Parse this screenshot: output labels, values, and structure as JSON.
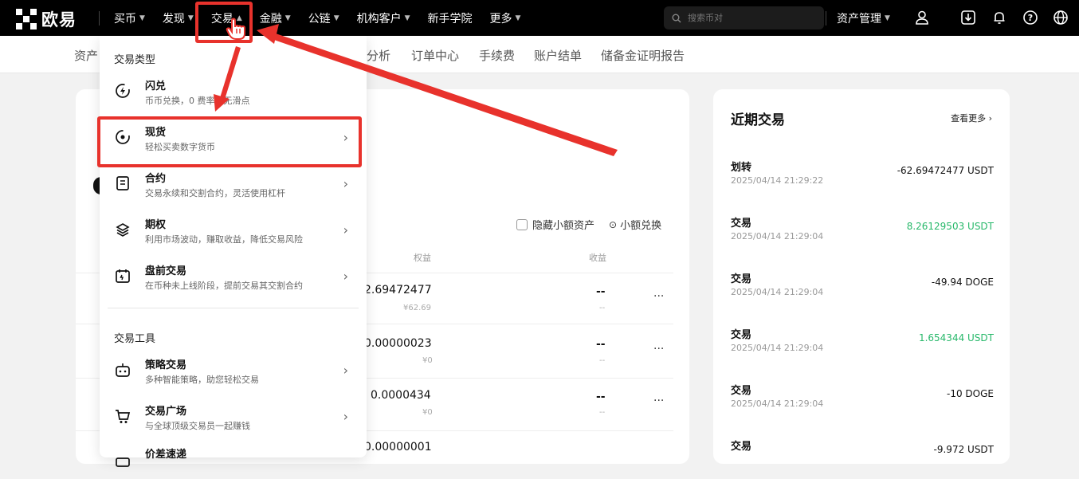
{
  "brand": {
    "name": "欧易"
  },
  "nav": {
    "items": [
      {
        "label": "买币",
        "chevron": true
      },
      {
        "label": "发现",
        "chevron": true
      },
      {
        "label": "交易",
        "chevron": true
      },
      {
        "label": "金融",
        "chevron": true
      },
      {
        "label": "公链",
        "chevron": true
      },
      {
        "label": "机构客户",
        "chevron": true
      },
      {
        "label": "新手学院",
        "chevron": false
      },
      {
        "label": "更多",
        "chevron": true
      }
    ],
    "search_placeholder": "搜索币对",
    "asset_management": "资产管理",
    "icons": [
      "user-icon",
      "download-icon",
      "bell-icon",
      "help-icon",
      "globe-icon"
    ]
  },
  "subnav": {
    "items": [
      "资产",
      "分析",
      "订单中心",
      "手续费",
      "账户结单",
      "储备金证明报告"
    ]
  },
  "dropdown": {
    "section1": "交易类型",
    "items1": [
      {
        "title": "闪兑",
        "desc": "币币兑换，0 费率，无滑点",
        "chevron": false,
        "icon": "flash-icon"
      },
      {
        "title": "现货",
        "desc": "轻松买卖数字货币",
        "chevron": true,
        "icon": "spot-icon"
      },
      {
        "title": "合约",
        "desc": "交易永续和交割合约，灵活使用杠杆",
        "chevron": true,
        "icon": "contract-icon"
      },
      {
        "title": "期权",
        "desc": "利用市场波动，赚取收益，降低交易风险",
        "chevron": true,
        "icon": "options-icon"
      },
      {
        "title": "盘前交易",
        "desc": "在币种未上线阶段，提前交易其交割合约",
        "chevron": true,
        "icon": "premarket-icon"
      }
    ],
    "section2": "交易工具",
    "items2": [
      {
        "title": "策略交易",
        "desc": "多种智能策略，助您轻松交易",
        "chevron": true,
        "icon": "bot-icon"
      },
      {
        "title": "交易广场",
        "desc": "与全球顶级交易员一起赚钱",
        "chevron": true,
        "icon": "cart-icon"
      },
      {
        "title": "价差速递",
        "desc": "",
        "chevron": false,
        "icon": "spread-icon"
      }
    ]
  },
  "assets": {
    "hide_small": "隐藏小额资产",
    "small_exchange": "小额兑换",
    "col_equity": "权益",
    "col_pnl": "收益",
    "rows": [
      {
        "amount": "2.69472477",
        "fiat": "¥62.69",
        "pnl": "--",
        "pnl_sub": "--"
      },
      {
        "amount": "0.00000023",
        "fiat": "¥0",
        "pnl": "--",
        "pnl_sub": "--"
      },
      {
        "amount": "0.0000434",
        "fiat": "¥0",
        "pnl": "--",
        "pnl_sub": "--"
      },
      {
        "amount": "0.00000001",
        "fiat": "",
        "pnl": "",
        "pnl_sub": ""
      }
    ],
    "more": "···"
  },
  "recent": {
    "title": "近期交易",
    "see_more": "查看更多",
    "rows": [
      {
        "type": "划转",
        "time": "2025/04/14 21:29:22",
        "amount": "-62.69472477 USDT",
        "positive": false
      },
      {
        "type": "交易",
        "time": "2025/04/14 21:29:04",
        "amount": "8.26129503 USDT",
        "positive": true
      },
      {
        "type": "交易",
        "time": "2025/04/14 21:29:04",
        "amount": "-49.94 DOGE",
        "positive": false
      },
      {
        "type": "交易",
        "time": "2025/04/14 21:29:04",
        "amount": "1.654344 USDT",
        "positive": true
      },
      {
        "type": "交易",
        "time": "2025/04/14 21:29:04",
        "amount": "-10 DOGE",
        "positive": false
      },
      {
        "type": "交易",
        "time": "",
        "amount": "-9.972 USDT",
        "positive": false
      }
    ]
  },
  "colors": {
    "accent_red": "#e8322c",
    "positive_green": "#27b86a",
    "nav_bg": "#000000"
  }
}
